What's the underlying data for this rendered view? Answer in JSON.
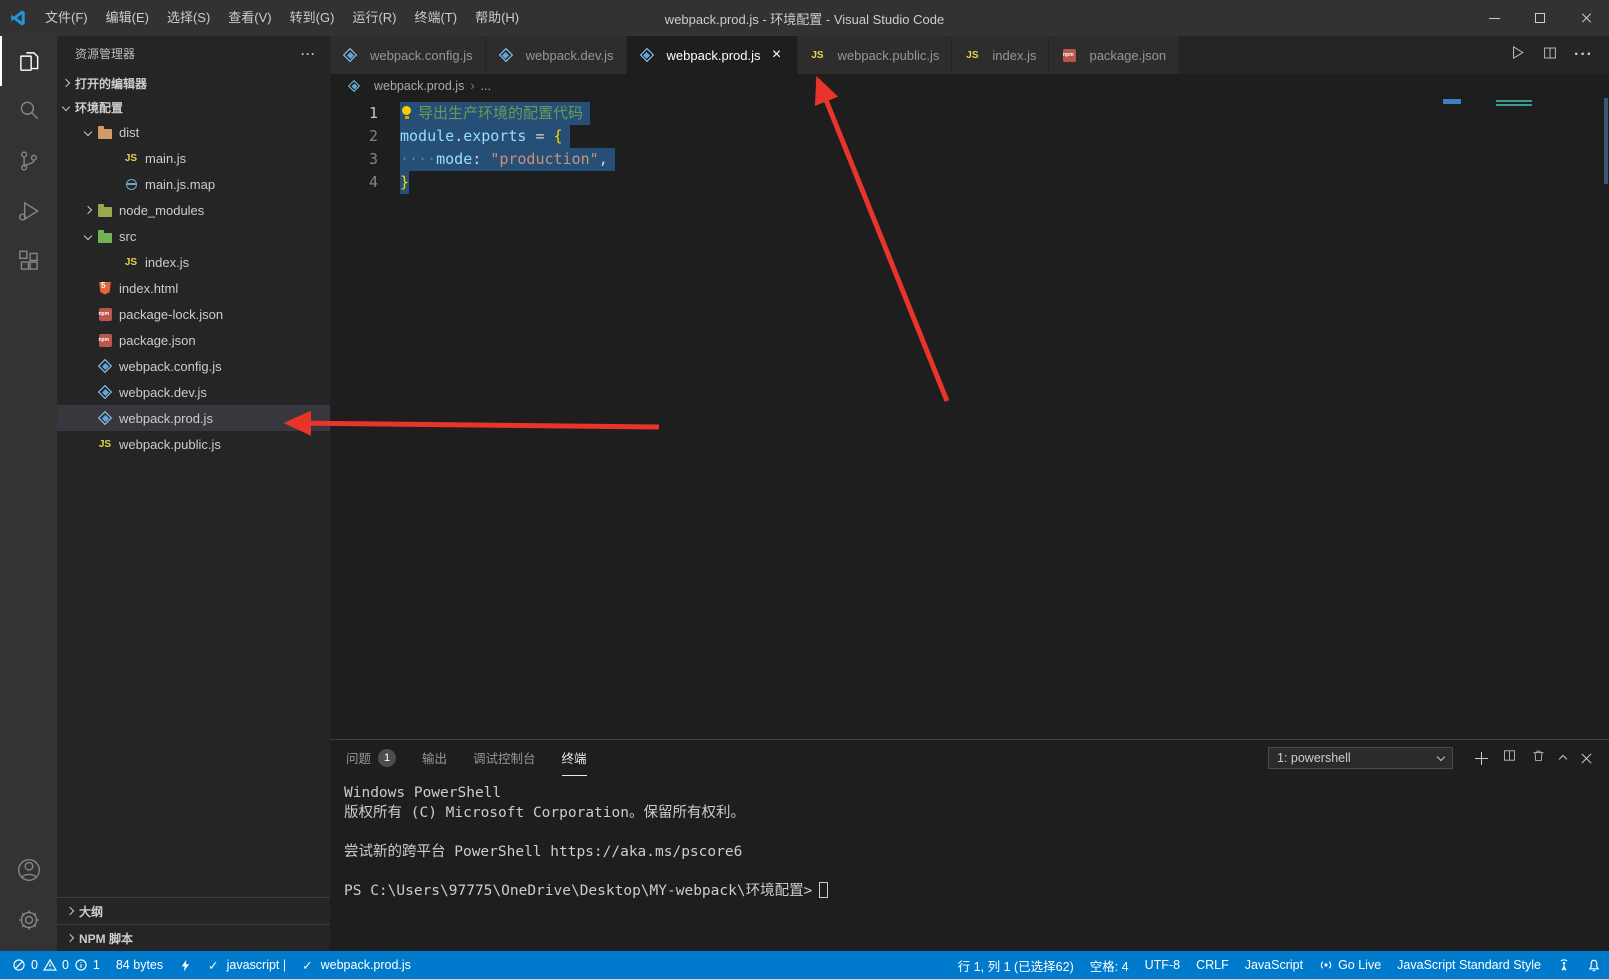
{
  "colors": {
    "status_bar": "#007acc",
    "annotation_red": "#e8352a",
    "selection": "#264f78",
    "activity_bar": "#333333",
    "sidebar": "#252526",
    "editor": "#1e1e1e"
  },
  "title_bar": {
    "menus": [
      "文件(F)",
      "编辑(E)",
      "选择(S)",
      "查看(V)",
      "转到(G)",
      "运行(R)",
      "终端(T)",
      "帮助(H)"
    ],
    "title": "webpack.prod.js - 环境配置 - Visual Studio Code"
  },
  "activity_bar": {
    "icons": [
      "explorer",
      "search",
      "source-control",
      "run-debug",
      "extensions",
      "account",
      "settings"
    ]
  },
  "sidebar": {
    "header": "资源管理器",
    "open_editors": "打开的编辑器",
    "section": "环境配置",
    "tree": [
      {
        "label": "dist",
        "icon": "folder-dist"
      },
      {
        "label": "main.js",
        "icon": "js"
      },
      {
        "label": "main.js.map",
        "icon": "source-map"
      },
      {
        "label": "node_modules",
        "icon": "folder-node"
      },
      {
        "label": "src",
        "icon": "folder-src"
      },
      {
        "label": "index.js",
        "icon": "js"
      },
      {
        "label": "index.html",
        "icon": "html"
      },
      {
        "label": "package-lock.json",
        "icon": "npm"
      },
      {
        "label": "package.json",
        "icon": "npm"
      },
      {
        "label": "webpack.config.js",
        "icon": "webpack"
      },
      {
        "label": "webpack.dev.js",
        "icon": "webpack"
      },
      {
        "label": "webpack.prod.js",
        "icon": "webpack"
      },
      {
        "label": "webpack.public.js",
        "icon": "js"
      }
    ],
    "outline": "大纲",
    "npm_scripts": "NPM 脚本"
  },
  "editor": {
    "tabs": [
      {
        "label": "webpack.config.js",
        "icon": "webpack"
      },
      {
        "label": "webpack.dev.js",
        "icon": "webpack"
      },
      {
        "label": "webpack.prod.js",
        "icon": "webpack"
      },
      {
        "label": "webpack.public.js",
        "icon": "js"
      },
      {
        "label": "index.js",
        "icon": "js"
      },
      {
        "label": "package.json",
        "icon": "npm"
      }
    ],
    "breadcrumb": {
      "file": "webpack.prod.js",
      "more": "..."
    },
    "line_numbers": [
      "1",
      "2",
      "3",
      "4"
    ],
    "code": {
      "l1_comment": "导出生产环境的配置代码",
      "l2_module": "module",
      "l2_dot": ".",
      "l2_exports": "exports",
      "l2_eq": " = ",
      "l2_brace": "{",
      "l3_ws": "····",
      "l3_mode": "mode",
      "l3_colon": ": ",
      "l3_string": "\"production\"",
      "l3_comma": ",",
      "l4_brace": "}"
    }
  },
  "panel": {
    "tabs": {
      "problems": "问题",
      "output": "输出",
      "debug_console": "调试控制台",
      "terminal": "终端"
    },
    "problems_badge": "1",
    "terminal_select": "1: powershell",
    "terminal_lines": [
      "Windows PowerShell",
      "版权所有 (C) Microsoft Corporation。保留所有权利。",
      "",
      "尝试新的跨平台 PowerShell https://aka.ms/pscore6",
      "",
      "PS C:\\Users\\97775\\OneDrive\\Desktop\\MY-webpack\\环境配置>"
    ]
  },
  "status_bar": {
    "errors": "0",
    "warnings": "0",
    "infos": "1",
    "size": "84 bytes",
    "lint_lang": "javascript |",
    "lint_file": "webpack.prod.js",
    "cursor": "行 1, 列 1 (已选择62)",
    "indent": "空格: 4",
    "encoding": "UTF-8",
    "eol": "CRLF",
    "language": "JavaScript",
    "go_live": "Go Live",
    "standard": "JavaScript Standard Style"
  }
}
